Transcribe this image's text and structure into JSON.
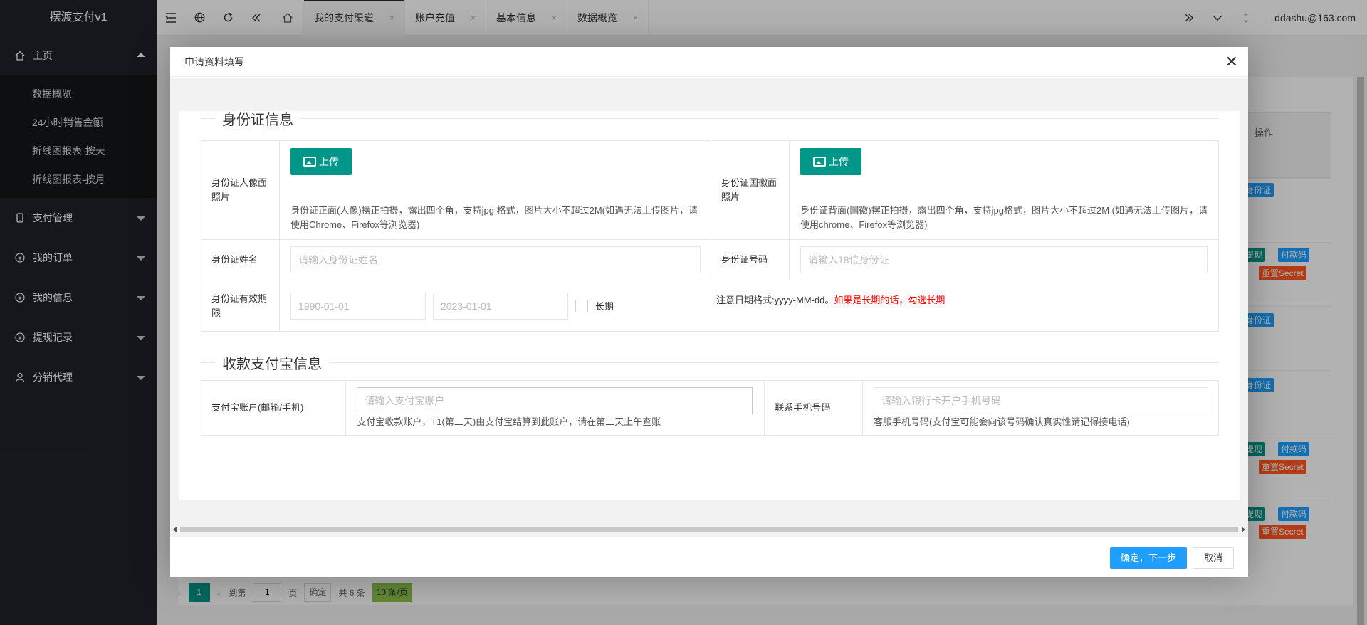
{
  "app": {
    "title": "摆渡支付v1"
  },
  "sidebar": {
    "groups": [
      {
        "label": "主页",
        "icon": "home-icon",
        "expanded": true,
        "items": [
          "数据概览",
          "24小时销售金额",
          "折线图报表-按天",
          "折线图报表-按月"
        ]
      },
      {
        "label": "支付管理",
        "icon": "phone-icon"
      },
      {
        "label": "我的订单",
        "icon": "yen-icon"
      },
      {
        "label": "我的信息",
        "icon": "yen-icon"
      },
      {
        "label": "提现记录",
        "icon": "yen-icon"
      },
      {
        "label": "分销代理",
        "icon": "user-icon"
      }
    ]
  },
  "topbar": {
    "tabs": [
      {
        "label": "我的支付渠道",
        "close": "×",
        "active": true
      },
      {
        "label": "账户充值",
        "close": "×"
      },
      {
        "label": "基本信息",
        "close": "×"
      },
      {
        "label": "数据概览",
        "close": "×"
      }
    ],
    "user": "ddashu@163.com"
  },
  "background": {
    "op_header": "操作",
    "btn_id": "身份证",
    "btn_withdraw": "提现",
    "btn_paycode": "付款码",
    "btn_reset": "重置Secret",
    "pager": {
      "page": "1",
      "goto_label": "到第",
      "goto_value": "1",
      "page_unit": "页",
      "ok": "确定",
      "total": "共 6 条",
      "size": "10 条/页"
    }
  },
  "modal": {
    "title": "申请资料填写",
    "close": "✕",
    "id_section": {
      "title": "身份证信息",
      "front_label": "身份证人像面照片",
      "back_label": "身份证国徽面照片",
      "upload_label": "上传",
      "front_hint": "身份证正面(人像)摆正拍摄，露出四个角，支持jpg 格式，图片大小不超过2M(如遇无法上传图片，请使用Chrome、Firefox等浏览器)",
      "back_hint": "身份证背面(国徽)摆正拍摄，露出四个角，支持jpg格式，图片大小不超过2M (如遇无法上传图片，请使用chrome、Firefox等浏览器)",
      "name_label": "身份证姓名",
      "name_placeholder": "请输入身份证姓名",
      "number_label": "身份证号码",
      "number_placeholder": "请输入18位身份证",
      "validity_label": "身份证有效期限",
      "start_placeholder": "1990-01-01",
      "end_placeholder": "2023-01-01",
      "longterm_label": "长期",
      "date_note": "注意日期格式:yyyy-MM-dd。",
      "date_note_red": "如果是长期的话，勾选长期"
    },
    "alipay_section": {
      "title": "收款支付宝信息",
      "account_label": "支付宝账户(邮箱/手机)",
      "account_placeholder": "请输入支付宝账户",
      "account_hint": "支付宝收款账户，T1(第二天)由支付宝结算到此账户，请在第二天上午查账",
      "phone_label": "联系手机号码",
      "phone_placeholder": "请输入银行卡开户手机号码",
      "phone_hint": "客服手机号码(支付宝可能会向该号码确认真实性请记得接电话)"
    },
    "confirm": "确定，下一步",
    "cancel": "取消"
  },
  "colors": {
    "sidebar": "#20222a",
    "primary": "#1e9fff",
    "green": "#009688",
    "orange": "#ff5722"
  }
}
